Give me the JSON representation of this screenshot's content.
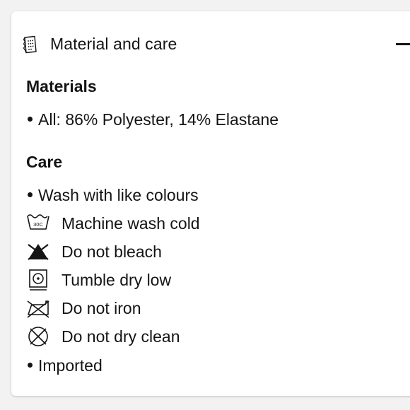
{
  "header": {
    "title": "Material and care",
    "icon": "fabric-tag-icon",
    "toggle_icon": "minus-icon"
  },
  "materials": {
    "heading": "Materials",
    "items": [
      "All: 86% Polyester, 14% Elastane"
    ]
  },
  "care": {
    "heading": "Care",
    "intro": "Wash with like colours",
    "instructions": [
      {
        "icon": "wash-30c-icon",
        "label": "Machine wash cold",
        "icon_text": "30C"
      },
      {
        "icon": "no-bleach-icon",
        "label": "Do not bleach"
      },
      {
        "icon": "tumble-dry-low-icon",
        "label": "Tumble dry low"
      },
      {
        "icon": "no-iron-icon",
        "label": "Do not iron"
      },
      {
        "icon": "no-dry-clean-icon",
        "label": "Do not dry clean"
      }
    ],
    "outro": "Imported"
  }
}
